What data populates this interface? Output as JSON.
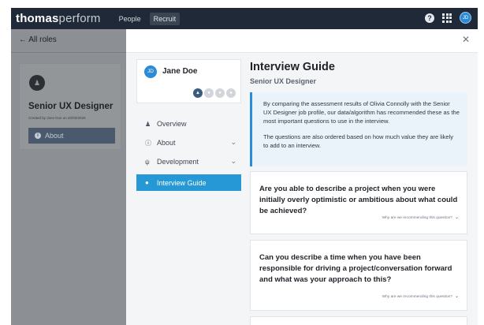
{
  "topbar": {
    "logo_bold": "thomas",
    "logo_light": "perform",
    "nav": [
      "People",
      "Recruit"
    ],
    "help_icon": "?",
    "avatar_initials": "JD"
  },
  "left_panel": {
    "back_label": "All roles",
    "role_title": "Senior UX Designer",
    "role_subtitle": "Created by Jane Doe on 20/03/2020",
    "about_button": "About"
  },
  "profile": {
    "initials": "JD",
    "name": "Jane Doe",
    "badges": [
      "behaviour-icon",
      "aptitude-icon",
      "personality-icon",
      "emotional-intelligence-icon"
    ]
  },
  "menu": {
    "items": [
      {
        "label": "Overview",
        "icon": "person-check-icon",
        "expandable": false
      },
      {
        "label": "About",
        "icon": "info-icon",
        "expandable": true
      },
      {
        "label": "Development",
        "icon": "sprout-icon",
        "expandable": true
      },
      {
        "label": "Interview Guide",
        "icon": "chat-icon",
        "expandable": false,
        "active": true
      }
    ]
  },
  "guide": {
    "title": "Interview Guide",
    "subtitle": "Senior UX Designer",
    "info_p1": "By comparing the assessment results of Olivia Connolly with the Senior UX Designer job profile, our data/algorithm has recommended these as the most important questions to use in the interview.",
    "info_p2": "The questions are also ordered based on how much value they are likely to add to an interview.",
    "questions": [
      {
        "text": "Are you able to describe a project when you were initially overly optimistic or ambitious about what could be achieved?",
        "why": "Why are we recommending this question?"
      },
      {
        "text": "Can you describe a time when you have been responsible for driving a project/conversation forward and what was your approach to this?",
        "why": "Why are we recommending this question?"
      }
    ]
  },
  "colors": {
    "topbar": "#1f2937",
    "accent": "#2b8bd6",
    "menu_active": "#2798d6",
    "info_bg": "#eaf3fa"
  }
}
